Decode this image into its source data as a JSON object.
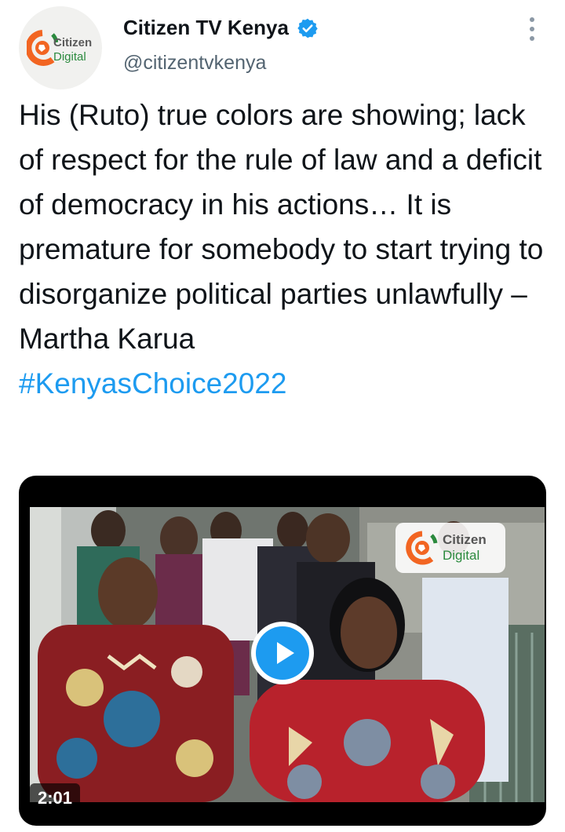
{
  "account": {
    "display_name": "Citizen TV Kenya",
    "handle": "@citizentvkenya",
    "verified": true,
    "avatar_logo": {
      "line1": "Citizen",
      "line2": "Digital"
    }
  },
  "tweet": {
    "text": "His (Ruto) true colors are showing; lack of respect for the rule of law and a deficit of democracy in his actions… It is premature for somebody to start trying to disorganize political parties unlawfully – Martha Karua",
    "hashtag": "#KenyasChoice2022"
  },
  "video": {
    "duration": "2:01",
    "watermark": {
      "line1": "Citizen",
      "line2": "Digital"
    }
  },
  "colors": {
    "accent": "#1d9bf0",
    "text": "#0f1419",
    "secondary_text": "#536471",
    "logo_orange": "#f26522",
    "logo_green": "#2b8a3e"
  },
  "icons": {
    "verified": "verified-badge-icon",
    "more": "more-options-icon",
    "play": "play-icon"
  }
}
